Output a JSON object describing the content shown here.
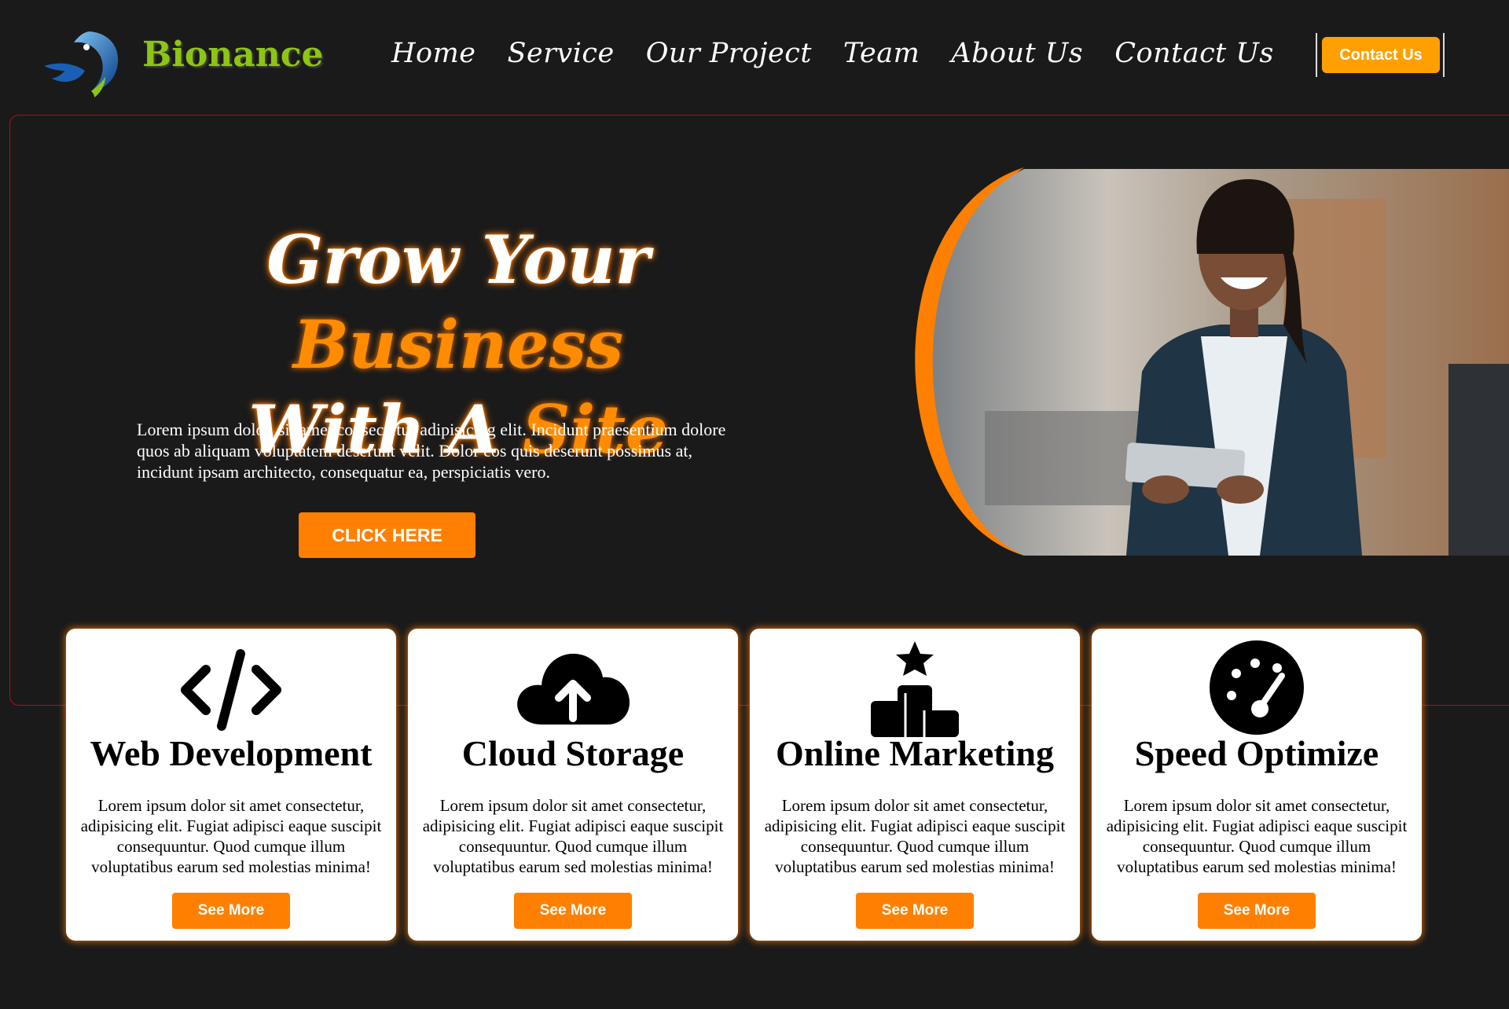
{
  "colors": {
    "background": "#1a1a1a",
    "accent": "#ff8000",
    "brand": "#8cc514",
    "cta": "#ffa000"
  },
  "header": {
    "brand": "Bionance",
    "logo_icon": "blue-bird-logo",
    "nav": [
      "Home",
      "Service",
      "Our Project",
      "Team",
      "About Us",
      "Contact Us"
    ],
    "cta_label": "Contact Us"
  },
  "hero": {
    "title_line1_plain": "Grow Your ",
    "title_line1_highlight": "Business",
    "title_line2_plain": "With A ",
    "title_line2_highlight": "Site",
    "text": "Lorem ipsum dolor, sit amet consectetur adipisicing elit. Incidunt praesentium dolore quos ab aliquam voluptatem deserunt velit. Dolor eos quis deserunt possimus at, incidunt ipsam architecto, consequatur ea, perspiciatis vero.",
    "button": "CLICK HERE",
    "photo": "smiling-businesswoman-with-tablet"
  },
  "services": [
    {
      "icon": "code-icon",
      "title": "Web Development",
      "text": "Lorem ipsum dolor sit amet consectetur, adipisicing elit. Fugiat adipisci eaque suscipit consequuntur. Quod cumque illum voluptatibus earum sed molestias minima!",
      "button": "See More"
    },
    {
      "icon": "cloud-upload-icon",
      "title": "Cloud Storage",
      "text": "Lorem ipsum dolor sit amet consectetur, adipisicing elit. Fugiat adipisci eaque suscipit consequuntur. Quod cumque illum voluptatibus earum sed molestias minima!",
      "button": "See More"
    },
    {
      "icon": "ranking-podium-icon",
      "title": "Online Marketing",
      "text": "Lorem ipsum dolor sit amet consectetur, adipisicing elit. Fugiat adipisci eaque suscipit consequuntur. Quod cumque illum voluptatibus earum sed molestias minima!",
      "button": "See More"
    },
    {
      "icon": "speedometer-icon",
      "title": "Speed Optimize",
      "text": "Lorem ipsum dolor sit amet consectetur, adipisicing elit. Fugiat adipisci eaque suscipit consequuntur. Quod cumque illum voluptatibus earum sed molestias minima!",
      "button": "See More"
    }
  ]
}
